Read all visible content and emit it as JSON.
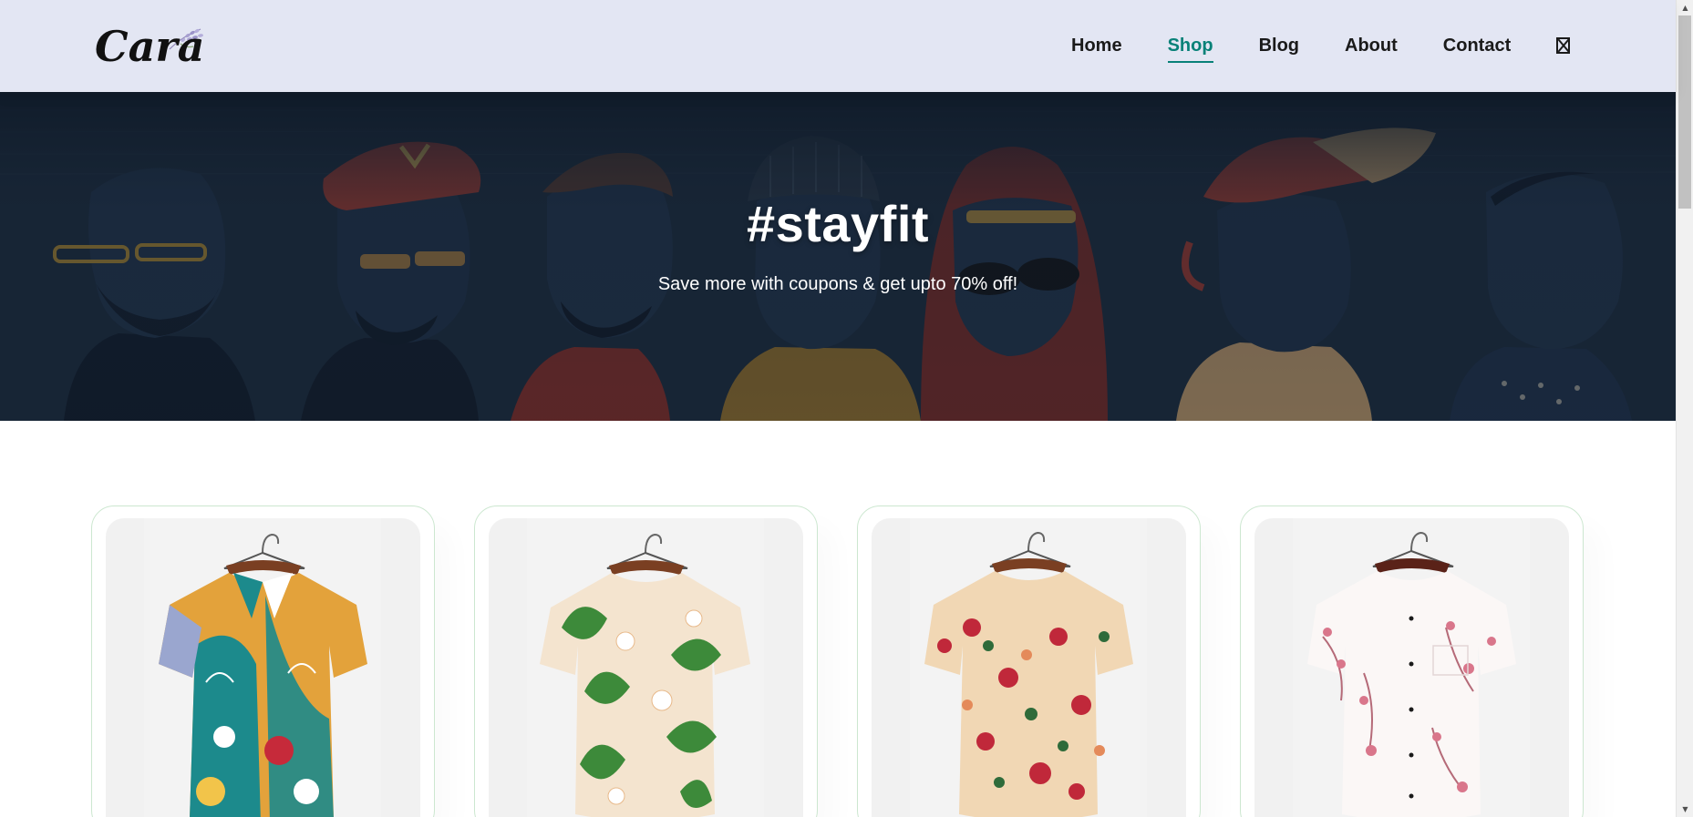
{
  "brand": {
    "logo_text": "Cara"
  },
  "nav": {
    "items": [
      {
        "label": "Home"
      },
      {
        "label": "Shop"
      },
      {
        "label": "Blog"
      },
      {
        "label": "About"
      },
      {
        "label": "Contact"
      }
    ],
    "active": "Shop",
    "cart_icon": "broken-glyph-icon"
  },
  "hero": {
    "title": "#stayfit",
    "subtitle": "Save more with coupons & get upto 70% off!",
    "background_image": "illustrated-group-of-men"
  },
  "products": [
    {
      "image": "abstract-multicolor-shirt"
    },
    {
      "image": "tropical-leaf-print-shirt"
    },
    {
      "image": "red-floral-print-shirt"
    },
    {
      "image": "white-pink-blossom-shirt"
    }
  ],
  "colors": {
    "header_bg": "#e3e6f3",
    "accent": "#088178",
    "hero_bg": "#1b2a3a",
    "card_border": "#cce7d0"
  }
}
